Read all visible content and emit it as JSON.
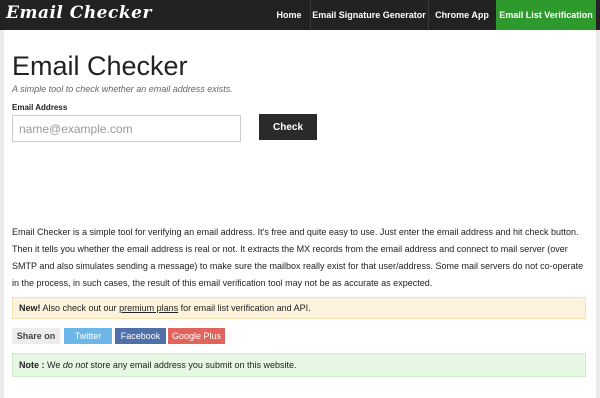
{
  "nav": {
    "brand": "Email Checker",
    "items": [
      {
        "label": "Home"
      },
      {
        "label": "Email Signature Generator"
      },
      {
        "label": "Chrome App"
      },
      {
        "label": "Email List Verification"
      }
    ],
    "active_color": "#2e9a2e",
    "bg_color": "#222222"
  },
  "main": {
    "title": "Email Checker",
    "subtitle": "A simple tool to check whether an email address exists.",
    "field_label": "Email Address",
    "input_placeholder": "name@example.com",
    "input_value": "",
    "check_label": "Check"
  },
  "description": "Email Checker is a simple tool for verifying an email address. It's free and quite easy to use. Just enter the email address and hit check button. Then it tells you whether the email address is real or not. It extracts the MX records from the email address and connect to mail server (over SMTP and also simulates sending a message) to make sure the mailbox really exist for that user/address. Some mail servers do not co-operate in the process, in such cases, the result of this email verification tool may not be as accurate as expected.",
  "new_alert": {
    "strong": "New!",
    "before_link": " Also check out our ",
    "link": "premium plans",
    "after_link": " for email list verification and API."
  },
  "share": {
    "label": "Share on",
    "buttons": [
      {
        "label": "Twitter",
        "color": "#6cb6e8"
      },
      {
        "label": "Facebook",
        "color": "#4f6fa8"
      },
      {
        "label": "Google Plus",
        "color": "#e0635c"
      }
    ]
  },
  "note": {
    "strong": "Note :",
    "before_em": " We ",
    "em": "do not",
    "after_em": " store any email address you submit on this website."
  }
}
